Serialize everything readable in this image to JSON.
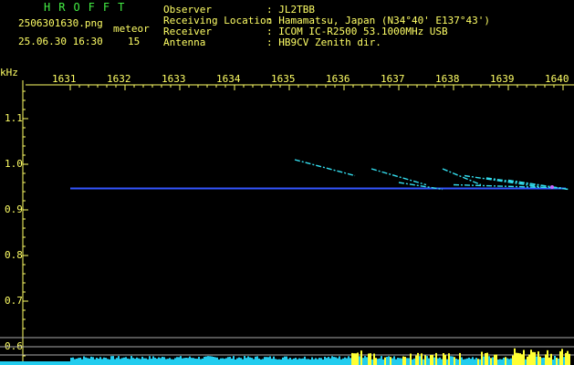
{
  "header": {
    "title": "HROFFT",
    "filename": "2506301630.png",
    "datetime": "25.06.30 16:30",
    "meteor_label": "meteor",
    "meteor_count": "15",
    "info": [
      {
        "label": "Observer",
        "value": ": JL2TBB"
      },
      {
        "label": "Receiving Location",
        "value": ": Hamamatsu, Japan (N34°40' E137°43')"
      },
      {
        "label": "Receiver",
        "value": ": ICOM IC-R2500 53.1000MHz USB"
      },
      {
        "label": "Antenna",
        "value": ": HB9CV Zenith dir."
      }
    ]
  },
  "axes": {
    "y_unit": "kHz",
    "y_ticks": [
      "1.1",
      "1.0",
      "0.9",
      "0.8",
      "0.7",
      "0.6"
    ],
    "x_ticks": [
      "1631",
      "1632",
      "1633",
      "1634",
      "1635",
      "1636",
      "1637",
      "1638",
      "1639",
      "1640"
    ]
  },
  "colors": {
    "background": "#000000",
    "axis_text": "#ffff66",
    "title_text": "#44ee44",
    "carrier": "#3355ff",
    "meteor": "#33ddee",
    "level_fill": "#22ccee",
    "level_peak": "#ffff33",
    "grid": "#aaaaaa"
  },
  "chart_data": {
    "type": "scatter",
    "xlabel": "",
    "ylabel": "kHz",
    "xlim": [
      16.3,
      16.4
    ],
    "ylim": [
      0.58,
      1.17
    ],
    "carrier": {
      "freq": 0.947,
      "x_start": 1631.0,
      "x_end": 1640.0
    },
    "meteor_trails": [
      {
        "x": [
          1635.1,
          1636.2
        ],
        "y": [
          1.01,
          0.975
        ]
      },
      {
        "x": [
          1636.5,
          1637.5
        ],
        "y": [
          0.99,
          0.955
        ]
      },
      {
        "x": [
          1637.0,
          1637.8
        ],
        "y": [
          0.96,
          0.945
        ]
      },
      {
        "x": [
          1637.8,
          1638.5
        ],
        "y": [
          0.99,
          0.955
        ]
      },
      {
        "x": [
          1638.2,
          1639.6
        ],
        "y": [
          0.975,
          0.95
        ]
      },
      {
        "x": [
          1638.6,
          1640.1
        ],
        "y": [
          0.97,
          0.945
        ]
      },
      {
        "x": [
          1639.0,
          1640.1
        ],
        "y": [
          0.965,
          0.945
        ]
      },
      {
        "x": [
          1638.0,
          1640.0
        ],
        "y": [
          0.955,
          0.948
        ]
      }
    ]
  }
}
